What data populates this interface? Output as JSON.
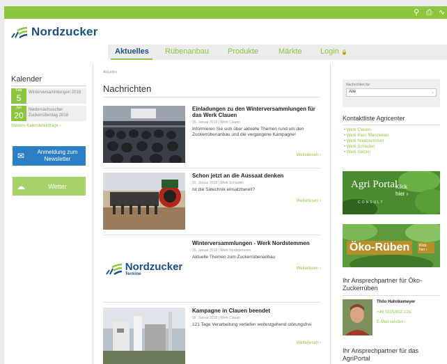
{
  "topbar": {
    "icons": [
      "search-icon",
      "print-icon",
      "rss-icon"
    ]
  },
  "brand": {
    "name": "Nordzucker"
  },
  "nav": {
    "items": [
      {
        "label": "Aktuelles",
        "active": true
      },
      {
        "label": "Rübenanbau",
        "active": false
      },
      {
        "label": "Produkte",
        "active": false
      },
      {
        "label": "Märkte",
        "active": false
      },
      {
        "label": "Login",
        "active": false
      }
    ]
  },
  "calendar": {
    "title": "Kalender",
    "entries": [
      {
        "month": "Feb",
        "day": "5",
        "text": "Winterversammlungen 2018"
      },
      {
        "month": "Jun",
        "day": "20",
        "text": "Niedersächsischer Zuckerrübentag 2018"
      }
    ],
    "more": "Weitere Kalendereinträge ›"
  },
  "newsletter_button": "Anmeldung zum Newsletter",
  "wetter_button": "Wetter",
  "breadcrumb": "Aktuelles",
  "main": {
    "title": "Nachrichten",
    "articles": [
      {
        "title": "Einladungen zu den Winterversammlungen für das Werk Clauen",
        "meta": "16. Januar 2018 | Werk Clauen",
        "text": "Informieren Sie sich über aktuelle Themen rund um den Zuckerrübenanbau und die vergangene Kampagne!",
        "more": "Weiterlesen ›"
      },
      {
        "title": "Schon jetzt an die Aussaat denken",
        "meta": "16. Januar 2018 | Werk Schladen",
        "text": "Ist die Sätechnik einsatzbereit?",
        "more": "Weiterlesen ›"
      },
      {
        "title": "Winterversammlungen - Werk Nordstemmen",
        "meta": "16. Januar 2018 | Werk Nordstemmen",
        "text": "Aktuelle Themen zum Zuckerrübenanbau",
        "more": "Weiterlesen ›"
      },
      {
        "title": "Kampagne in Clauen beendet",
        "meta": "16. Januar 2018 | Werk Clauen",
        "text": "121 Tage Verarbeitung verliefen weitestgehend störungsfrei",
        "more": "Weiterlesen ›"
      }
    ],
    "termine_logo": {
      "name": "Nordzucker",
      "sub": "Termine"
    }
  },
  "sidebar": {
    "filter_label": "Nachrichten für:",
    "filter_value": "Alle",
    "kontakt_title": "Kontaktliste Agricenter",
    "kontakt_items": [
      "Werk Clauen",
      "Werk Klein Wanzleben",
      "Werk Nordstemmen",
      "Werk Schladen",
      "Werk Uelzen"
    ],
    "agri_banner": {
      "logo": "Agri Portal",
      "logo_sub": "CONSULT",
      "cta": "Klick hier ›"
    },
    "oeko_banner": {
      "text": "Öko-Rüben",
      "cta": "Klick hier ›"
    },
    "oeko_title": "Ihr Ansprechpartner für Öko-Zuckerrüben",
    "person": {
      "name": "Thilo Hahnkemeyer",
      "phone": "+49 5335/802-128",
      "mail": "E-Mail senden ›"
    },
    "agri_title": "Ihr Ansprechpartner für das AgriPortal"
  }
}
